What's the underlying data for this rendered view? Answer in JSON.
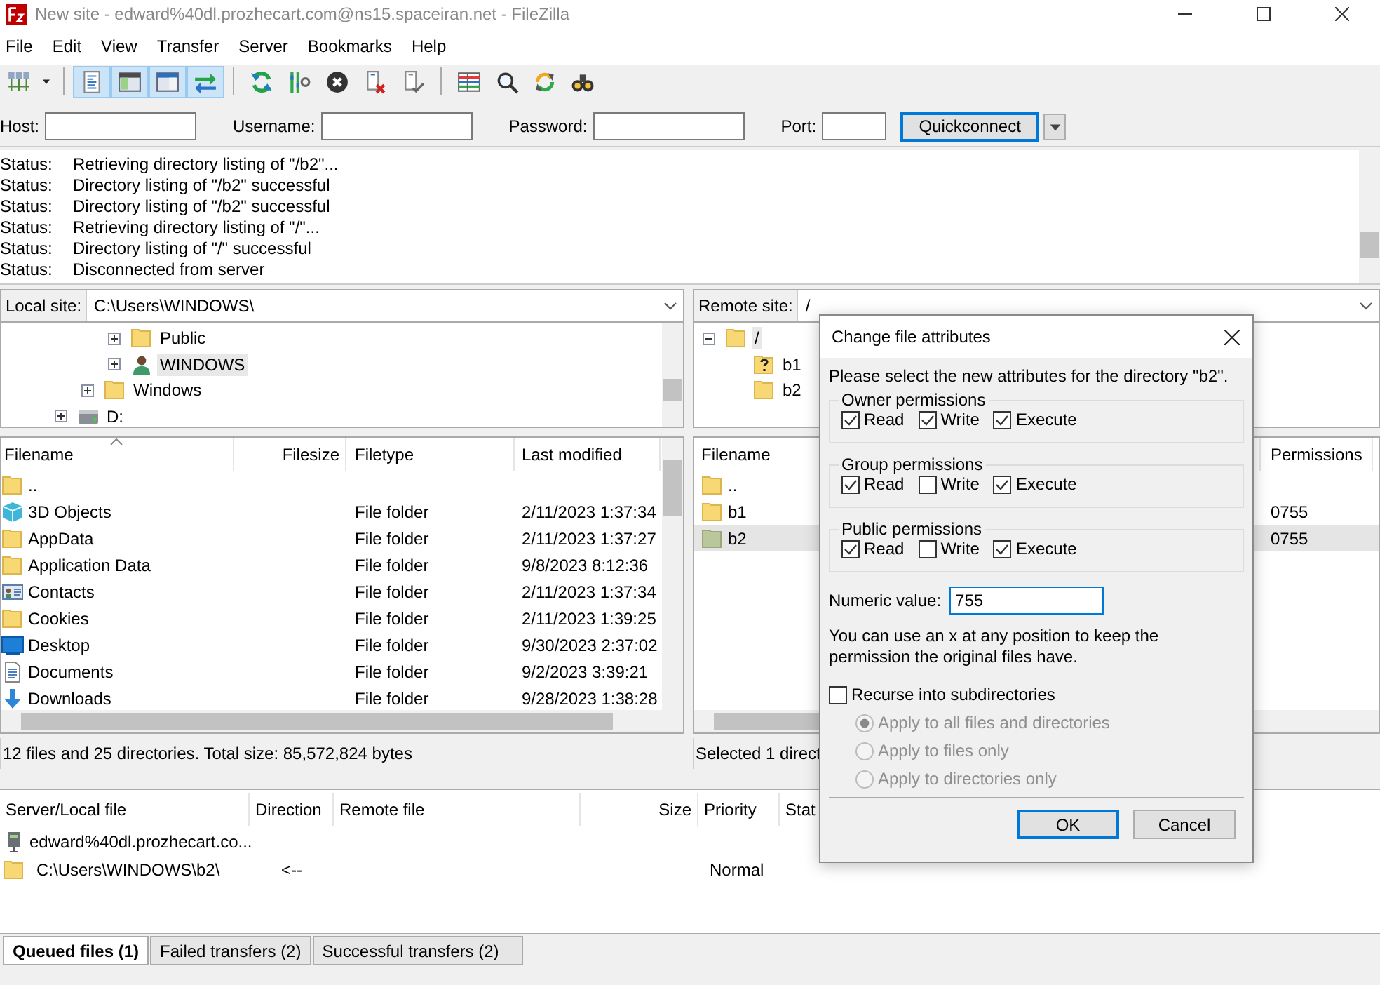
{
  "window": {
    "title": "New site - edward%40dl.prozhecart.com@ns15.spaceiran.net - FileZilla"
  },
  "menu": [
    "File",
    "Edit",
    "View",
    "Transfer",
    "Server",
    "Bookmarks",
    "Help"
  ],
  "toolbar": [
    [
      {
        "kind": "site-manager",
        "on": false
      },
      {
        "kind": "caret",
        "on": false
      }
    ],
    [
      {
        "kind": "message-log",
        "on": true
      },
      {
        "kind": "local-tree",
        "on": true
      },
      {
        "kind": "remote-tree",
        "on": true
      },
      {
        "kind": "transfer-queue",
        "on": true
      }
    ],
    [
      {
        "kind": "refresh",
        "on": false
      },
      {
        "kind": "filters",
        "on": false
      },
      {
        "kind": "cancel",
        "on": false
      },
      {
        "kind": "disconnect",
        "on": false
      },
      {
        "kind": "reconnect",
        "on": false
      }
    ],
    [
      {
        "kind": "compare",
        "on": false
      },
      {
        "kind": "search",
        "on": false
      },
      {
        "kind": "sync",
        "on": false
      },
      {
        "kind": "find",
        "on": false
      }
    ]
  ],
  "quickconnect": {
    "fields": [
      {
        "label": "Host:",
        "kind": "wide"
      },
      {
        "label": "Username:",
        "kind": "wide"
      },
      {
        "label": "Password:",
        "kind": "wide"
      },
      {
        "label": "Port:",
        "kind": "narrow"
      }
    ],
    "button": "Quickconnect"
  },
  "log": [
    {
      "label": "Status:",
      "message": "Retrieving directory listing of \"/b2\"..."
    },
    {
      "label": "Status:",
      "message": "Directory listing of \"/b2\" successful"
    },
    {
      "label": "Status:",
      "message": "Directory listing of \"/b2\" successful"
    },
    {
      "label": "Status:",
      "message": "Retrieving directory listing of \"/\"..."
    },
    {
      "label": "Status:",
      "message": "Directory listing of \"/\" successful"
    },
    {
      "label": "Status:",
      "message": "Disconnected from server"
    }
  ],
  "local": {
    "site_label": "Local site:",
    "path": "C:\\Users\\WINDOWS\\",
    "tree": [
      {
        "children": [
          {
            "children": [
              {
                "label": "Public",
                "kind": "folder",
                "expanded": false,
                "selected": false
              },
              {
                "label": "WINDOWS",
                "kind": "user",
                "expanded": false,
                "selected": true
              }
            ]
          },
          {
            "label": "Windows",
            "kind": "folder",
            "expanded": false,
            "selected": false
          }
        ]
      },
      {
        "label": "D:",
        "kind": "drive",
        "expanded": false,
        "selected": false
      }
    ],
    "columns": [
      "Filename",
      "Filesize",
      "Filetype",
      "Last modified"
    ],
    "rows": [
      {
        "name": "..",
        "kind": "folder",
        "type": "",
        "modified": ""
      },
      {
        "name": "3D Objects",
        "kind": "cube",
        "type": "File folder",
        "modified": "2/11/2023 1:37:34"
      },
      {
        "name": "AppData",
        "kind": "folder",
        "type": "File folder",
        "modified": "2/11/2023 1:37:27"
      },
      {
        "name": "Application Data",
        "kind": "folder",
        "type": "File folder",
        "modified": "9/8/2023 8:12:36"
      },
      {
        "name": "Contacts",
        "kind": "contacts",
        "type": "File folder",
        "modified": "2/11/2023 1:37:34"
      },
      {
        "name": "Cookies",
        "kind": "folder",
        "type": "File folder",
        "modified": "2/11/2023 1:39:25"
      },
      {
        "name": "Desktop",
        "kind": "desktop",
        "type": "File folder",
        "modified": "9/30/2023 2:37:02"
      },
      {
        "name": "Documents",
        "kind": "documents",
        "type": "File folder",
        "modified": "9/2/2023 3:39:21"
      },
      {
        "name": "Downloads",
        "kind": "download",
        "type": "File folder",
        "modified": "9/28/2023 1:38:28"
      }
    ],
    "status": "12 files and 25 directories. Total size: 85,572,824 bytes"
  },
  "remote": {
    "site_label": "Remote site:",
    "path": "/",
    "tree": [
      {
        "label": "/",
        "kind": "folder",
        "expanded": true,
        "selected": true,
        "children": [
          {
            "label": "b1",
            "kind": "unknown",
            "selected": false
          },
          {
            "label": "b2",
            "kind": "folder",
            "selected": false
          }
        ]
      }
    ],
    "columns": [
      "Filename",
      "Permissions"
    ],
    "rows": [
      {
        "name": "..",
        "permissions": "",
        "selected": false
      },
      {
        "name": "b1",
        "permissions": "0755",
        "selected": false
      },
      {
        "name": "b2",
        "permissions": "0755",
        "selected": true
      }
    ],
    "status": "Selected 1 direct"
  },
  "queue": {
    "columns": [
      "Server/Local file",
      "Direction",
      "Remote file",
      "Size",
      "Priority",
      "Stat"
    ],
    "rows": [
      {
        "kind": "server",
        "local": "edward%40dl.prozhecart.co...",
        "direction": "",
        "priority": ""
      },
      {
        "kind": "file",
        "local": "C:\\Users\\WINDOWS\\b2\\",
        "direction": "<--",
        "priority": "Normal"
      }
    ]
  },
  "tabs": [
    {
      "label": "Queued files (1)",
      "selected": true
    },
    {
      "label": "Failed transfers (2)",
      "selected": false
    },
    {
      "label": "Successful transfers (2)",
      "selected": false
    }
  ],
  "dialog": {
    "title": "Change file attributes",
    "intro": "Please select the new attributes for the directory \"b2\".",
    "groups": [
      {
        "title": "Owner permissions",
        "options": [
          {
            "label": "Read",
            "checked": true
          },
          {
            "label": "Write",
            "checked": true
          },
          {
            "label": "Execute",
            "checked": true
          }
        ]
      },
      {
        "title": "Group permissions",
        "options": [
          {
            "label": "Read",
            "checked": true
          },
          {
            "label": "Write",
            "checked": false
          },
          {
            "label": "Execute",
            "checked": true
          }
        ]
      },
      {
        "title": "Public permissions",
        "options": [
          {
            "label": "Read",
            "checked": true
          },
          {
            "label": "Write",
            "checked": false
          },
          {
            "label": "Execute",
            "checked": true
          }
        ]
      }
    ],
    "numeric_label": "Numeric value:",
    "numeric_value": "755",
    "hint": "You can use an x at any position to keep the permission the original files have.",
    "recurse": {
      "label": "Recurse into subdirectories",
      "checked": false
    },
    "apply_options": [
      {
        "label": "Apply to all files and directories",
        "selected": true,
        "disabled": true
      },
      {
        "label": "Apply to files only",
        "selected": false,
        "disabled": true
      },
      {
        "label": "Apply to directories only",
        "selected": false,
        "disabled": true
      }
    ],
    "buttons": [
      {
        "label": "OK",
        "default": true
      },
      {
        "label": "Cancel",
        "default": false
      }
    ]
  }
}
